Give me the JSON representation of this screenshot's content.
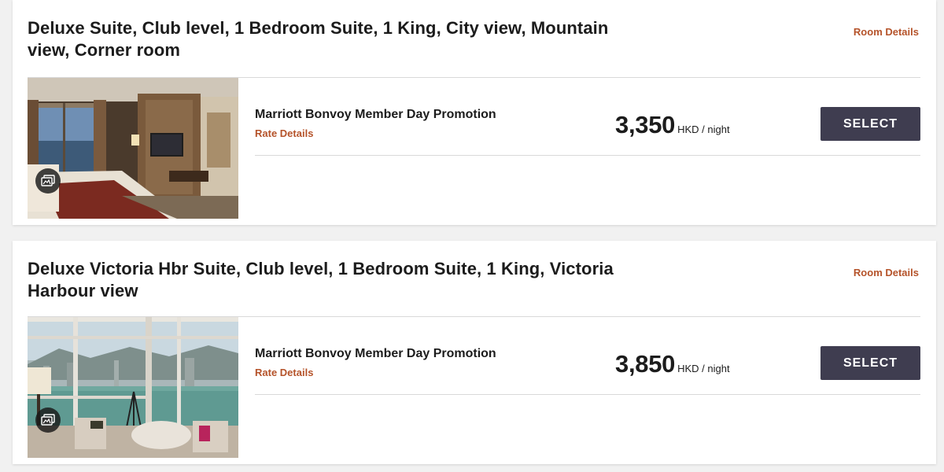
{
  "rooms": [
    {
      "title": "Deluxe Suite, Club level, 1 Bedroom Suite, 1 King, City view, Mountain view, Corner room",
      "room_details_label": "Room Details",
      "rate": {
        "name": "Marriott Bonvoy Member Day Promotion",
        "details_label": "Rate Details",
        "price": "3,350",
        "unit": "HKD / night",
        "select_label": "SELECT"
      }
    },
    {
      "title": "Deluxe Victoria Hbr Suite, Club level, 1 Bedroom Suite, 1 King, Victoria Harbour view",
      "room_details_label": "Room Details",
      "rate": {
        "name": "Marriott Bonvoy Member Day Promotion",
        "details_label": "Rate Details",
        "price": "3,850",
        "unit": "HKD / night",
        "select_label": "SELECT"
      }
    }
  ],
  "colors": {
    "accent_link": "#b5532a",
    "select_button": "#3f3d50",
    "page_background": "#f1f1f1"
  },
  "icons": {
    "gallery": "gallery-icon"
  }
}
